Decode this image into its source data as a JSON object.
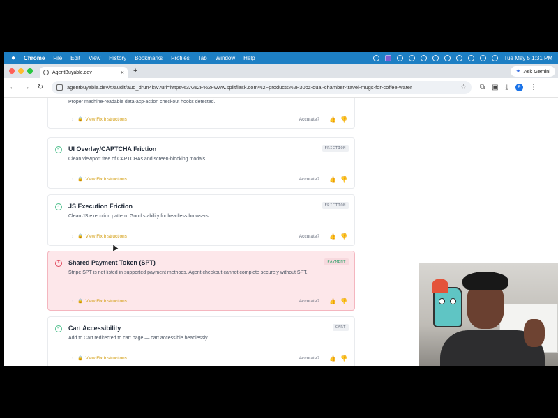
{
  "menubar": {
    "apple": "",
    "app": "Chrome",
    "items": [
      "File",
      "Edit",
      "View",
      "History",
      "Bookmarks",
      "Profiles",
      "Tab",
      "Window",
      "Help"
    ],
    "clock": "Tue May 5  1:31 PM"
  },
  "browser": {
    "tab_title": "AgentBuyable.dev",
    "tab_close": "×",
    "new_tab": "+",
    "ask_gemini": "Ask Gemini",
    "url": "agentbuyable.dev/#/audit/aud_drun4kw?url=https%3A%2F%2Fwww.splitflask.com%2Fproducts%2F30oz-dual-chamber-travel-mugs-for-coffee-water",
    "back": "←",
    "forward": "→",
    "reload": "↻",
    "star": "☆",
    "profile_initial": "R"
  },
  "checks": {
    "partial_desc": "Proper machine-readable data-acp-action checkout hooks detected.",
    "fix_label": "View Fix Instructions",
    "accurate_label": "Accurate?",
    "items": [
      {
        "title": "UI Overlay/CAPTCHA Friction",
        "desc": "Clean viewport free of CAPTCHAs and screen-blocking modals.",
        "badge": "FRICTION",
        "status": "pass"
      },
      {
        "title": "JS Execution Friction",
        "desc": "Clean JS execution pattern. Good stability for headless browsers.",
        "badge": "FRICTION",
        "status": "pass"
      },
      {
        "title": "Shared Payment Token (SPT)",
        "desc": "Stripe SPT is not listed in supported payment methods. Agent checkout cannot complete securely without SPT.",
        "badge": "PAYMENT",
        "status": "fail"
      },
      {
        "title": "Cart Accessibility",
        "desc": "Add to Cart redirected to cart page — cart accessible headlessly.",
        "badge": "CART",
        "status": "pass"
      }
    ]
  },
  "icons": {
    "pass": "✓",
    "fail": "×",
    "chevron": "›",
    "lock": "🔒",
    "thumb_up": "👍",
    "thumb_down": "👎"
  },
  "colors": {
    "menubar": "#1d7fc4",
    "pass": "#4fc08d",
    "fail": "#e0455a",
    "fail_bg": "#fde7ea",
    "link": "#d4a017"
  }
}
